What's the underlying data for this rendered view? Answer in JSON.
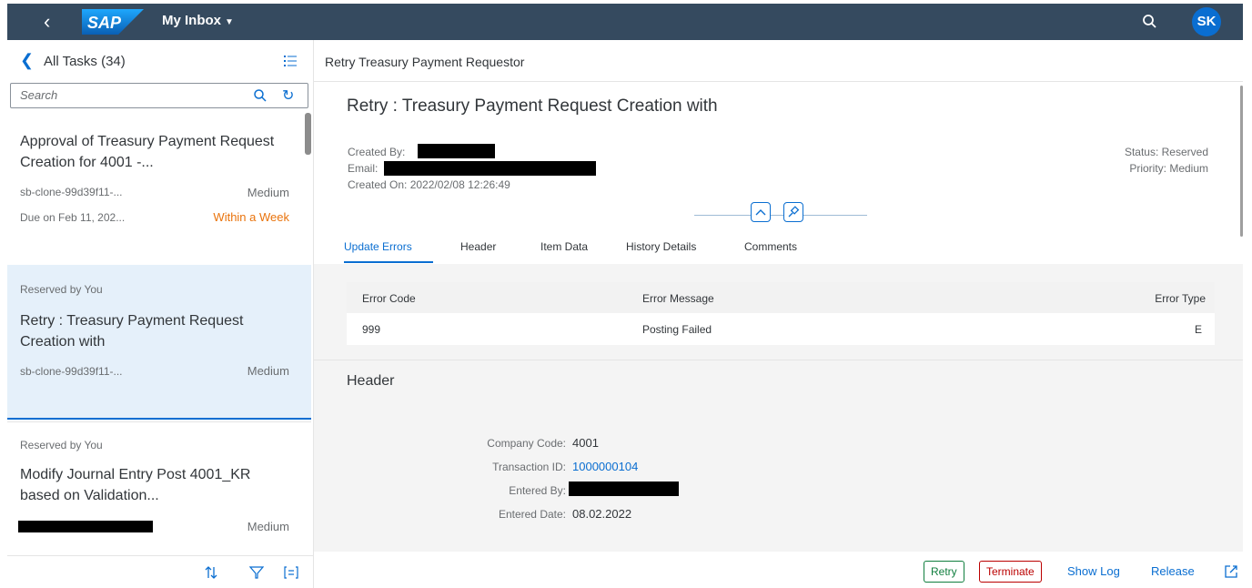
{
  "shell": {
    "logo_text": "SAP",
    "app_title": "My Inbox",
    "user_initials": "SK"
  },
  "master": {
    "title": "All Tasks (34)",
    "search_placeholder": "Search",
    "items": [
      {
        "title": "Approval of Treasury Payment Request Creation for 4001 -...",
        "origin": "sb-clone-99d39f11-...",
        "priority": "Medium",
        "due": "Due on Feb 11, 202...",
        "due_status": "Within a Week"
      },
      {
        "reserved": "Reserved by You",
        "title": "Retry : Treasury Payment Request Creation with",
        "origin": "sb-clone-99d39f11-...",
        "priority": "Medium"
      },
      {
        "reserved": "Reserved by You",
        "title": "Modify Journal Entry Post 4001_KR based on Validation...",
        "priority": "Medium"
      }
    ]
  },
  "detail": {
    "top_title": "Retry Treasury Payment Requestor",
    "object_title": "Retry : Treasury Payment Request Creation with",
    "created_by_label": "Created By:",
    "email_label": "Email:",
    "created_on": "Created On: 2022/02/08 12:26:49",
    "status": "Status: Reserved",
    "priority": "Priority: Medium",
    "tabs": [
      "Update Errors",
      "Header",
      "Item Data",
      "History Details",
      "Comments"
    ],
    "errors": {
      "columns": [
        "Error Code",
        "Error Message",
        "Error Type"
      ],
      "rows": [
        [
          "999",
          "Posting Failed",
          "E"
        ]
      ]
    },
    "header_section": {
      "title": "Header",
      "company_code_label": "Company Code:",
      "company_code": "4001",
      "transaction_id_label": "Transaction ID:",
      "transaction_id": "1000000104",
      "entered_by_label": "Entered By:",
      "entered_date_label": "Entered Date:",
      "entered_date": "08.02.2022"
    }
  },
  "footer": {
    "retry": "Retry",
    "terminate": "Terminate",
    "show_log": "Show Log",
    "release": "Release"
  },
  "colors": {
    "shell_bg": "#354a5f",
    "accent": "#0a6ed1",
    "selected_bg": "#e5f0fa",
    "warning": "#e9730c",
    "positive": "#107e3e",
    "negative": "#bb0000"
  }
}
